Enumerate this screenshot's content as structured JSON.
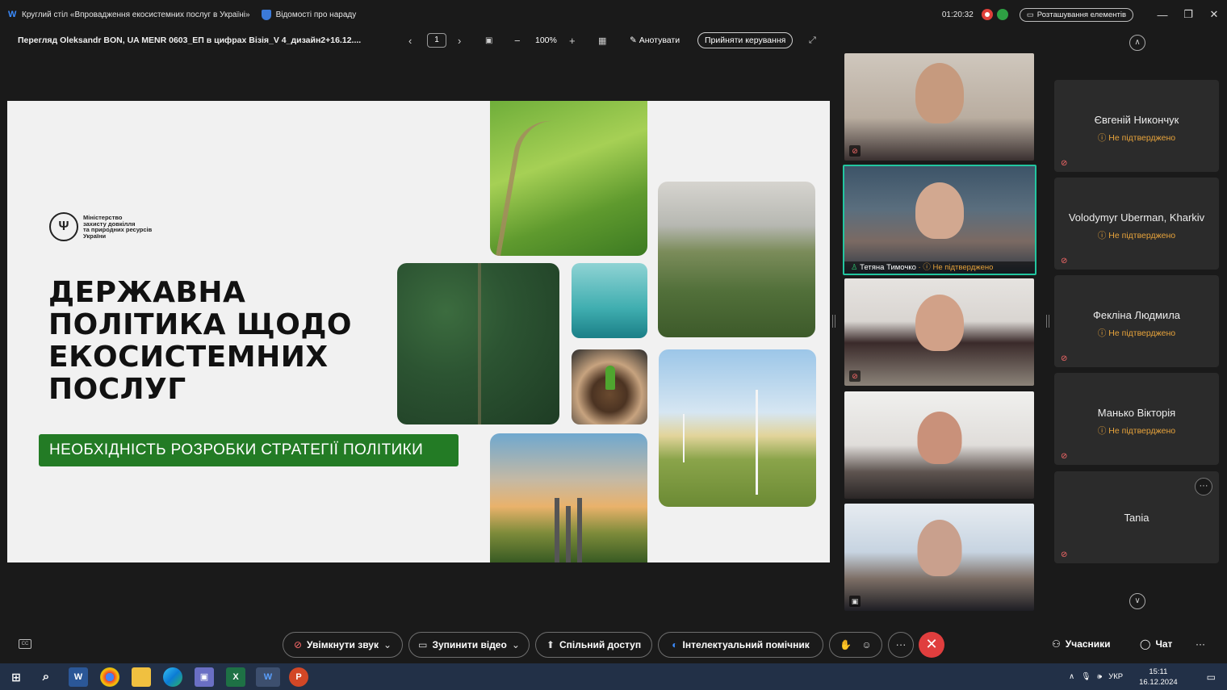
{
  "titlebar": {
    "meeting_title": "Круглий стіл «Впровадження екосистемних послуг в Україні»",
    "meeting_info": "Відомості про нараду",
    "elapsed": "01:20:32",
    "layout_button": "Розташування елементів",
    "minimize": "—",
    "restore": "❐",
    "close": "✕"
  },
  "viewer": {
    "doc_title": "Перегляд Oleksandr BON, UA MENR 0603_ЕП в цифрах Візія_V 4_дизайн2+16.12....",
    "prev": "‹",
    "next": "›",
    "page": "1",
    "zoom_out": "−",
    "zoom": "100%",
    "zoom_in": "+",
    "annotate": "Анотувати",
    "take_control": "Прийняти керування",
    "fullscreen": "⤢"
  },
  "slide": {
    "ministry_lines": [
      "Міністерство",
      "захисту довкілля",
      "та природних ресурсів",
      "України"
    ],
    "title_lines": [
      "ДЕРЖАВНА",
      "ПОЛІТИКА ЩОДО",
      "ЕКОСИСТЕМНИХ",
      "ПОСЛУГ"
    ],
    "subtitle": "НЕОБХІДНІСТЬ РОЗРОБКИ СТРАТЕГІЇ ПОЛІТИКИ"
  },
  "videos": [
    {
      "name": "",
      "status": ""
    },
    {
      "name": "Тетяна Тимочко",
      "status": "Не підтверджено"
    },
    {
      "name": "",
      "status": ""
    },
    {
      "name": "",
      "status": ""
    },
    {
      "name": "",
      "status": ""
    }
  ],
  "participants": [
    {
      "name": "Євгеній Никончук",
      "status": "Не підтверджено"
    },
    {
      "name": "Volodymyr Uberman, Kharkiv",
      "status": "Не підтверджено"
    },
    {
      "name": "Фекліна Людмила",
      "status": "Не підтверджено"
    },
    {
      "name": "Манько Вікторія",
      "status": "Не підтверджено"
    },
    {
      "name": "Tania",
      "status": ""
    }
  ],
  "controls": {
    "unmute": "Увімкнути звук",
    "stop_video": "Зупинити відео",
    "share": "Спільний доступ",
    "assistant": "Інтелектуальний помічник",
    "more": "···",
    "end": "✕",
    "participants": "Учасники",
    "chat": "Чат",
    "overflow": "···"
  },
  "taskbar": {
    "language": "УКР",
    "time": "15:11",
    "date": "16.12.2024"
  },
  "colors": {
    "accent_green": "#237b25",
    "active_speaker": "#22c6a0",
    "unverified": "#e7a33b",
    "end_call": "#e03e3e"
  }
}
